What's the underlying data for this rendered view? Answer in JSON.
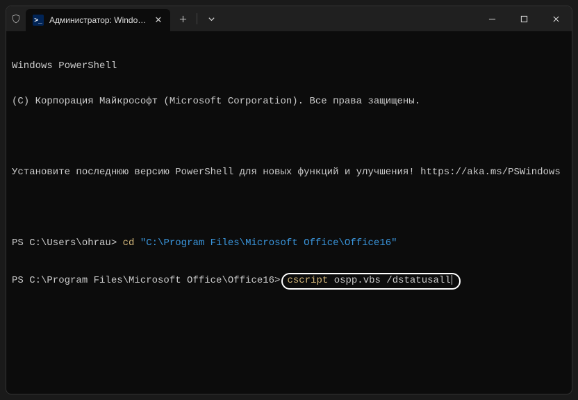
{
  "tab": {
    "title": "Администратор: Windows Pc",
    "icon_label": ">_"
  },
  "terminal": {
    "header_line1": "Windows PowerShell",
    "header_line2": "(C) Корпорация Майкрософт (Microsoft Corporation). Все права защищены.",
    "notice": "Установите последнюю версию PowerShell для новых функций и улучшения! https://aka.ms/PSWindows",
    "prompt1_prefix": "PS C:\\Users\\ohrau> ",
    "prompt1_cmd": "cd ",
    "prompt1_arg": "\"C:\\Program Files\\Microsoft Office\\Office16\"",
    "prompt2_prefix": "PS C:\\Program Files\\Microsoft Office\\Office16>",
    "highlight_cmd": "cscript ",
    "highlight_arg": "ospp.vbs /dstatusall"
  },
  "controls": {
    "new_tab": "+",
    "dropdown": "⌄",
    "minimize": "—",
    "maximize": "▢",
    "close": "✕",
    "tab_close": "✕"
  }
}
